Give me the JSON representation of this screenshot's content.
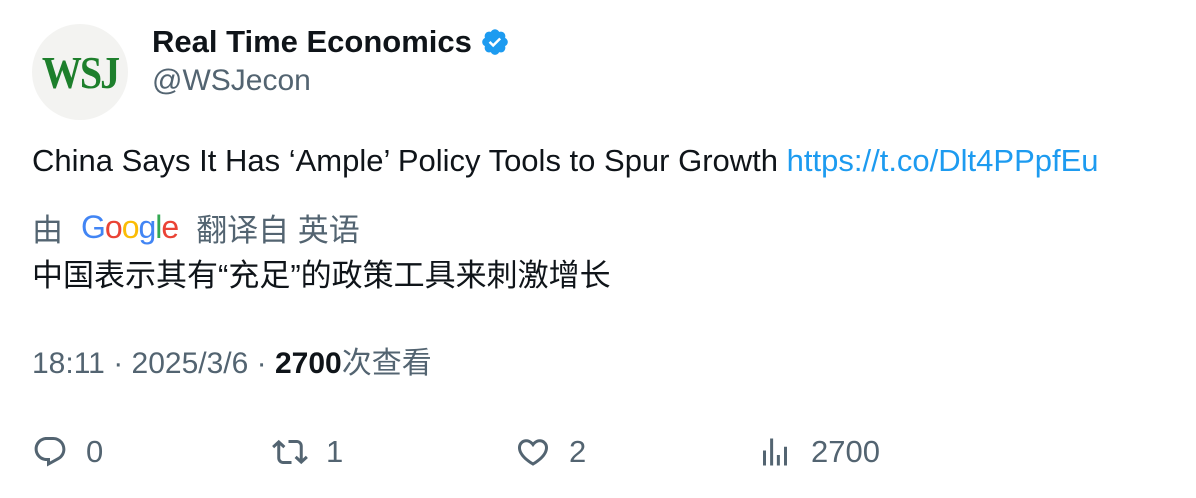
{
  "author": {
    "avatar_text": "WSJ",
    "display_name": "Real Time Economics",
    "handle": "@WSJecon",
    "verified_icon": "verified-badge-icon"
  },
  "tweet": {
    "text": "China Says It Has ‘Ample’ Policy Tools to Spur Growth ",
    "link": "https://t.co/Dlt4PPpfEu"
  },
  "translation": {
    "prefix": "由",
    "logo": {
      "G": "G",
      "o1": "o",
      "o2": "o",
      "g": "g",
      "l": "l",
      "e": "e"
    },
    "suffix": "翻译自 英语",
    "text": "中国表示其有“充足”的政策工具来刺激增长"
  },
  "meta": {
    "time": "18:11",
    "separator": " · ",
    "date": "2025/3/6",
    "views_count": "2700",
    "views_label": "次查看"
  },
  "actions": {
    "reply_count": "0",
    "retweet_count": "1",
    "like_count": "2",
    "views_count": "2700"
  },
  "colors": {
    "link": "#1d9bf0",
    "secondary_text": "#536471",
    "primary_text": "#0f1419",
    "verified": "#1d9bf0",
    "wsj_green": "#1d7f2c"
  }
}
